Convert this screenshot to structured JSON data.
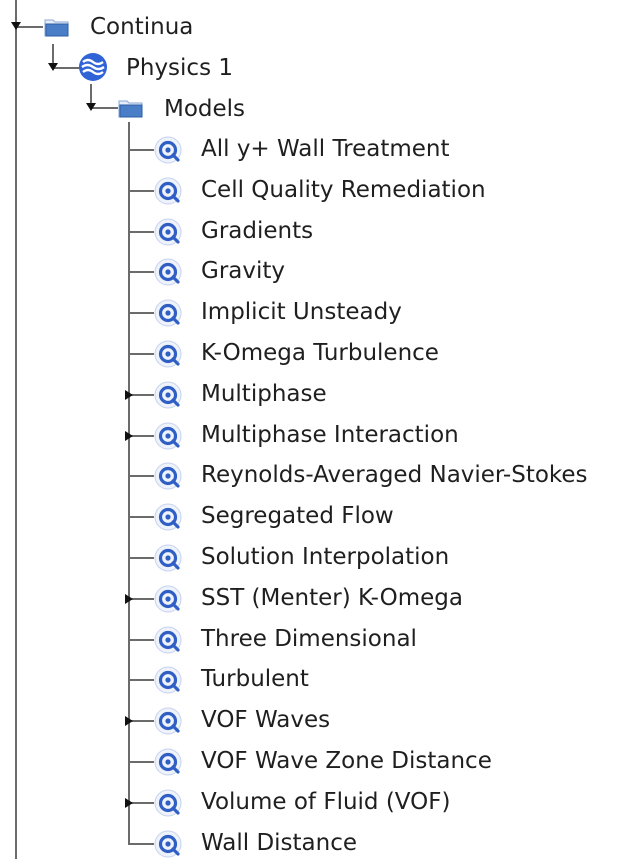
{
  "tree": {
    "root": {
      "label": "Continua",
      "icon": "folder-icon"
    },
    "physics": {
      "label": "Physics 1",
      "icon": "physics-continuum-icon"
    },
    "models_folder": {
      "label": "Models",
      "icon": "folder-icon"
    },
    "models": [
      {
        "label": "All y+ Wall Treatment",
        "expandable": false,
        "icon": "model-icon"
      },
      {
        "label": "Cell Quality Remediation",
        "expandable": false,
        "icon": "model-icon"
      },
      {
        "label": "Gradients",
        "expandable": false,
        "icon": "model-icon"
      },
      {
        "label": "Gravity",
        "expandable": false,
        "icon": "model-icon"
      },
      {
        "label": "Implicit Unsteady",
        "expandable": false,
        "icon": "model-icon"
      },
      {
        "label": "K-Omega Turbulence",
        "expandable": false,
        "icon": "model-icon"
      },
      {
        "label": "Multiphase",
        "expandable": true,
        "icon": "model-icon"
      },
      {
        "label": "Multiphase Interaction",
        "expandable": true,
        "icon": "model-icon"
      },
      {
        "label": "Reynolds-Averaged Navier-Stokes",
        "expandable": false,
        "icon": "model-icon"
      },
      {
        "label": "Segregated Flow",
        "expandable": false,
        "icon": "model-icon"
      },
      {
        "label": "Solution Interpolation",
        "expandable": false,
        "icon": "model-icon"
      },
      {
        "label": "SST (Menter) K-Omega",
        "expandable": true,
        "icon": "model-icon"
      },
      {
        "label": "Three Dimensional",
        "expandable": false,
        "icon": "model-icon"
      },
      {
        "label": "Turbulent",
        "expandable": false,
        "icon": "model-icon"
      },
      {
        "label": "VOF Waves",
        "expandable": true,
        "icon": "model-icon"
      },
      {
        "label": "VOF Wave Zone Distance",
        "expandable": false,
        "icon": "model-icon"
      },
      {
        "label": "Volume of Fluid (VOF)",
        "expandable": true,
        "icon": "model-icon"
      },
      {
        "label": "Wall Distance",
        "expandable": false,
        "icon": "model-icon"
      }
    ]
  },
  "colors": {
    "folder": "#4a7fc8",
    "physics": "#2f63d6",
    "model_ring": "#2f5fc4",
    "connector": "#6b6b6b"
  }
}
